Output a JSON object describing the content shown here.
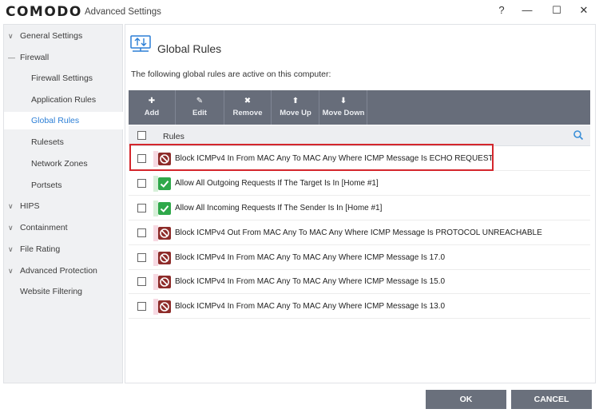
{
  "app": {
    "logo": "COMODO",
    "window_title": "Advanced Settings",
    "controls": {
      "help": "?",
      "minimize": "—",
      "maximize": "☐",
      "close": "✕"
    }
  },
  "sidebar": {
    "items": [
      {
        "label": "General Settings",
        "chevron": "∨"
      },
      {
        "label": "Firewall",
        "chevron": "—"
      },
      {
        "label": "Firewall Settings"
      },
      {
        "label": "Application Rules"
      },
      {
        "label": "Global Rules",
        "active": true
      },
      {
        "label": "Rulesets"
      },
      {
        "label": "Network Zones"
      },
      {
        "label": "Portsets"
      },
      {
        "label": "HIPS",
        "chevron": "∨"
      },
      {
        "label": "Containment",
        "chevron": "∨"
      },
      {
        "label": "File Rating",
        "chevron": "∨"
      },
      {
        "label": "Advanced Protection",
        "chevron": "∨"
      },
      {
        "label": "Website Filtering"
      }
    ]
  },
  "main": {
    "title": "Global Rules",
    "subtitle": "The following global rules are active on this computer:",
    "toolbar": {
      "add": {
        "icon": "✚",
        "label": "Add"
      },
      "edit": {
        "icon": "✎",
        "label": "Edit"
      },
      "remove": {
        "icon": "✖",
        "label": "Remove"
      },
      "move_up": {
        "icon": "⬆",
        "label": "Move Up"
      },
      "move_down": {
        "icon": "⬇",
        "label": "Move Down"
      }
    },
    "column_header": "Rules",
    "rules": [
      {
        "text": "Block ICMPv4 In From MAC Any To MAC Any Where ICMP Message Is ECHO REQUEST",
        "action": "block"
      },
      {
        "text": "Allow All Outgoing Requests If The Target Is In [Home #1]",
        "action": "allow"
      },
      {
        "text": "Allow All Incoming Requests If The Sender Is In [Home #1]",
        "action": "allow"
      },
      {
        "text": "Block ICMPv4 Out From MAC Any To MAC Any Where ICMP Message Is PROTOCOL UNREACHABLE",
        "action": "block"
      },
      {
        "text": "Block ICMPv4 In From MAC Any To MAC Any Where ICMP Message Is 17.0",
        "action": "block"
      },
      {
        "text": "Block ICMPv4 In From MAC Any To MAC Any Where ICMP Message Is 15.0",
        "action": "block"
      },
      {
        "text": "Block ICMPv4 In From MAC Any To MAC Any Where ICMP Message Is 13.0",
        "action": "block"
      }
    ]
  },
  "footer": {
    "ok": "OK",
    "cancel": "CANCEL"
  },
  "colors": {
    "toolbar_bg": "#676d7a",
    "active_nav": "#2c7fd6",
    "block_icon": "#8e2c2a",
    "allow_icon": "#2fa84a",
    "highlight": "#d4262c",
    "block_stripe": "#f7d9e2",
    "allow_stripe": "#d7f0d9"
  }
}
